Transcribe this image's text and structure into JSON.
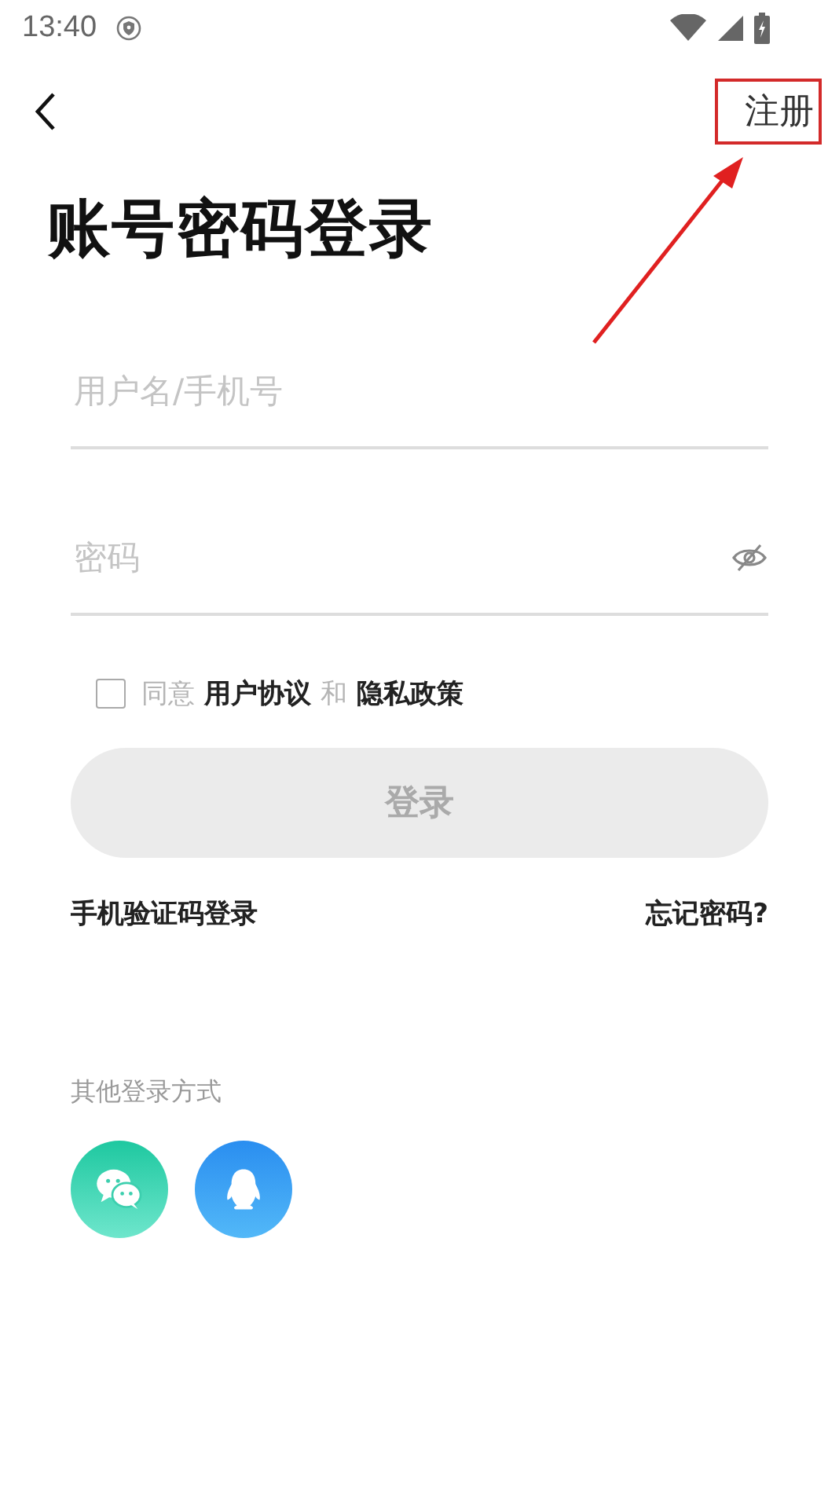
{
  "status_bar": {
    "time": "13:40"
  },
  "header": {
    "action": "注册"
  },
  "title": "账号密码登录",
  "fields": [
    {
      "kind": "text",
      "placeholder": "用户名/手机号"
    },
    {
      "kind": "password",
      "placeholder": "密码",
      "visible": false
    }
  ],
  "agreement": {
    "checked": false,
    "segments": [
      {
        "kind": "text",
        "text": "同意"
      },
      {
        "kind": "link",
        "text": "用户协议"
      },
      {
        "kind": "text",
        "text": "和"
      },
      {
        "kind": "link",
        "text": "隐私政策"
      }
    ]
  },
  "login_button": {
    "label": "登录",
    "disabled": true
  },
  "links": [
    {
      "label": "手机验证码登录"
    },
    {
      "label": "忘记密码?"
    }
  ],
  "other_login": {
    "label": "其他登录方式",
    "methods": [
      {
        "kind": "wechat"
      },
      {
        "kind": "qq"
      }
    ]
  }
}
